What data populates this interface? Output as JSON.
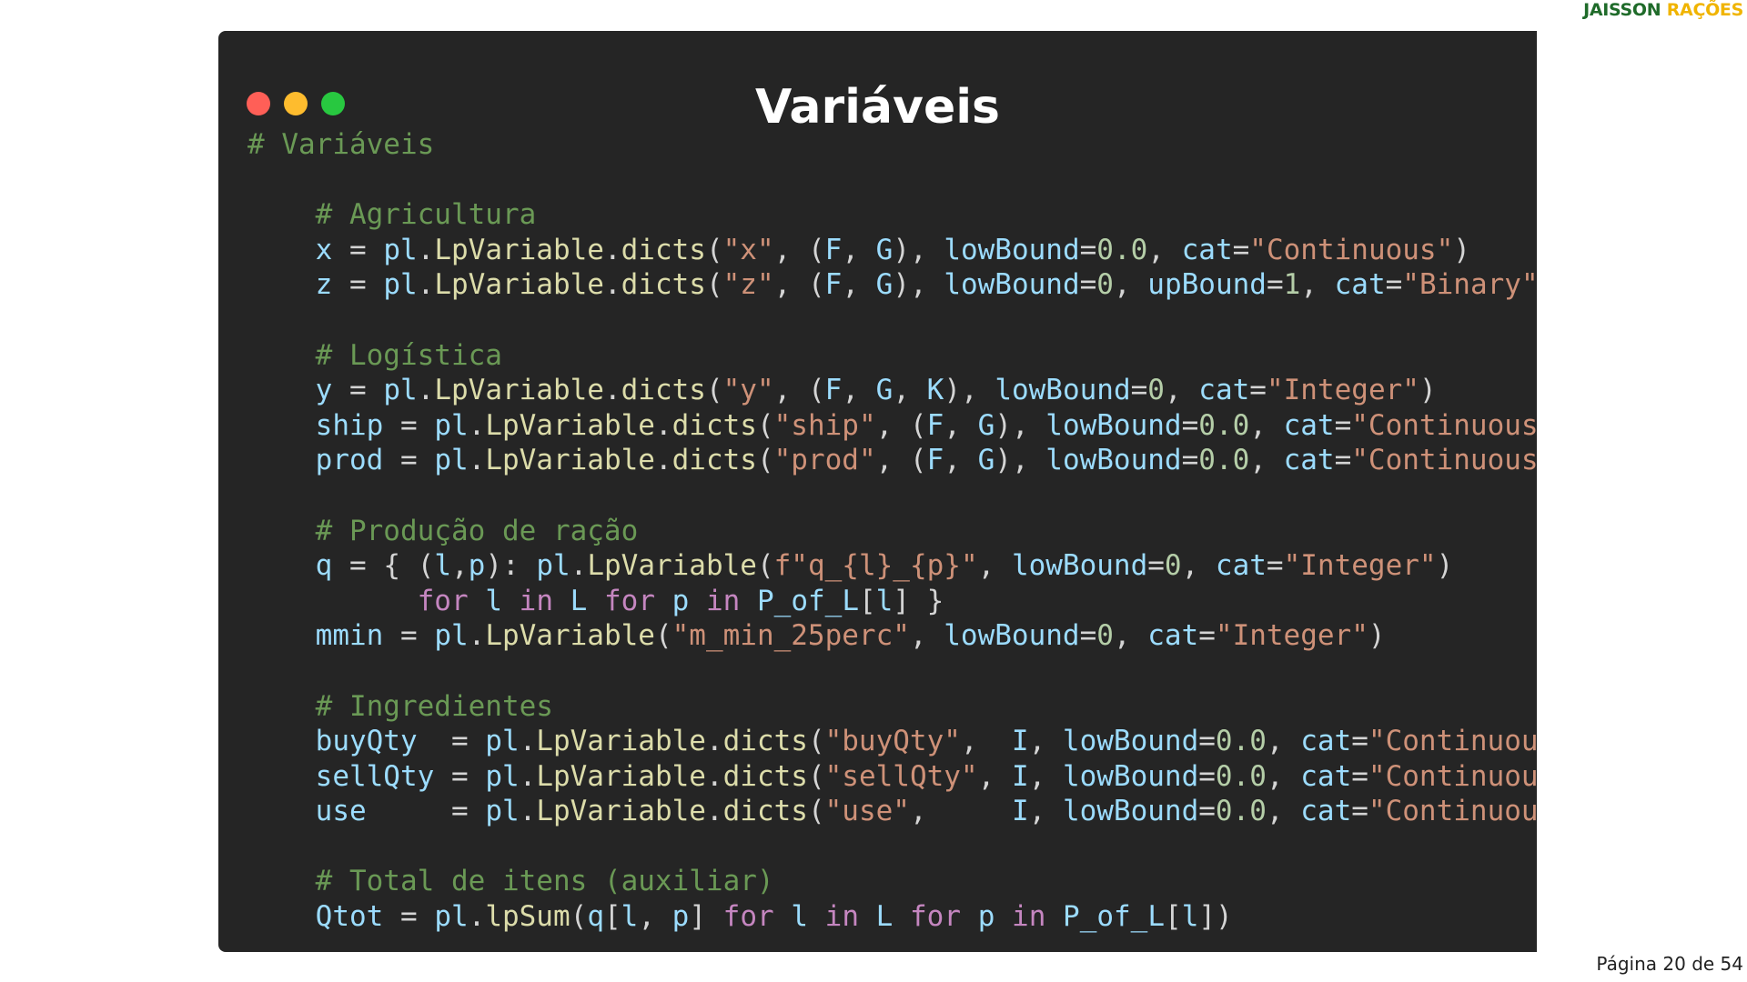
{
  "brand": {
    "part1": "JAISSON",
    "part2": "RAÇÕES",
    "color1": "#1f6b2a",
    "color2": "#f0b400"
  },
  "slide_title": "Variáveis",
  "footer": "Página 20 de 54",
  "window_dots": [
    "red",
    "yellow",
    "green"
  ],
  "code_lines": [
    [
      [
        "comment",
        "# Variáveis"
      ]
    ],
    [],
    [
      [
        "op",
        "    "
      ],
      [
        "comment",
        "# Agricultura"
      ]
    ],
    [
      [
        "op",
        "    "
      ],
      [
        "var",
        "x"
      ],
      [
        "op",
        " = "
      ],
      [
        "var",
        "pl"
      ],
      [
        "op",
        "."
      ],
      [
        "func",
        "LpVariable"
      ],
      [
        "op",
        "."
      ],
      [
        "func",
        "dicts"
      ],
      [
        "op",
        "("
      ],
      [
        "str",
        "\"x\""
      ],
      [
        "op",
        ", ("
      ],
      [
        "var",
        "F"
      ],
      [
        "op",
        ", "
      ],
      [
        "var",
        "G"
      ],
      [
        "op",
        "), "
      ],
      [
        "var",
        "lowBound"
      ],
      [
        "op",
        "="
      ],
      [
        "num",
        "0.0"
      ],
      [
        "op",
        ", "
      ],
      [
        "var",
        "cat"
      ],
      [
        "op",
        "="
      ],
      [
        "str",
        "\"Continuous\""
      ],
      [
        "op",
        ")"
      ]
    ],
    [
      [
        "op",
        "    "
      ],
      [
        "var",
        "z"
      ],
      [
        "op",
        " = "
      ],
      [
        "var",
        "pl"
      ],
      [
        "op",
        "."
      ],
      [
        "func",
        "LpVariable"
      ],
      [
        "op",
        "."
      ],
      [
        "func",
        "dicts"
      ],
      [
        "op",
        "("
      ],
      [
        "str",
        "\"z\""
      ],
      [
        "op",
        ", ("
      ],
      [
        "var",
        "F"
      ],
      [
        "op",
        ", "
      ],
      [
        "var",
        "G"
      ],
      [
        "op",
        "), "
      ],
      [
        "var",
        "lowBound"
      ],
      [
        "op",
        "="
      ],
      [
        "num",
        "0"
      ],
      [
        "op",
        ", "
      ],
      [
        "var",
        "upBound"
      ],
      [
        "op",
        "="
      ],
      [
        "num",
        "1"
      ],
      [
        "op",
        ", "
      ],
      [
        "var",
        "cat"
      ],
      [
        "op",
        "="
      ],
      [
        "str",
        "\"Binary\""
      ],
      [
        "op",
        ")"
      ]
    ],
    [],
    [
      [
        "op",
        "    "
      ],
      [
        "comment",
        "# Logística"
      ]
    ],
    [
      [
        "op",
        "    "
      ],
      [
        "var",
        "y"
      ],
      [
        "op",
        " = "
      ],
      [
        "var",
        "pl"
      ],
      [
        "op",
        "."
      ],
      [
        "func",
        "LpVariable"
      ],
      [
        "op",
        "."
      ],
      [
        "func",
        "dicts"
      ],
      [
        "op",
        "("
      ],
      [
        "str",
        "\"y\""
      ],
      [
        "op",
        ", ("
      ],
      [
        "var",
        "F"
      ],
      [
        "op",
        ", "
      ],
      [
        "var",
        "G"
      ],
      [
        "op",
        ", "
      ],
      [
        "var",
        "K"
      ],
      [
        "op",
        "), "
      ],
      [
        "var",
        "lowBound"
      ],
      [
        "op",
        "="
      ],
      [
        "num",
        "0"
      ],
      [
        "op",
        ", "
      ],
      [
        "var",
        "cat"
      ],
      [
        "op",
        "="
      ],
      [
        "str",
        "\"Integer\""
      ],
      [
        "op",
        ")"
      ]
    ],
    [
      [
        "op",
        "    "
      ],
      [
        "var",
        "ship"
      ],
      [
        "op",
        " = "
      ],
      [
        "var",
        "pl"
      ],
      [
        "op",
        "."
      ],
      [
        "func",
        "LpVariable"
      ],
      [
        "op",
        "."
      ],
      [
        "func",
        "dicts"
      ],
      [
        "op",
        "("
      ],
      [
        "str",
        "\"ship\""
      ],
      [
        "op",
        ", ("
      ],
      [
        "var",
        "F"
      ],
      [
        "op",
        ", "
      ],
      [
        "var",
        "G"
      ],
      [
        "op",
        "), "
      ],
      [
        "var",
        "lowBound"
      ],
      [
        "op",
        "="
      ],
      [
        "num",
        "0.0"
      ],
      [
        "op",
        ", "
      ],
      [
        "var",
        "cat"
      ],
      [
        "op",
        "="
      ],
      [
        "str",
        "\"Continuous\""
      ],
      [
        "op",
        ")"
      ]
    ],
    [
      [
        "op",
        "    "
      ],
      [
        "var",
        "prod"
      ],
      [
        "op",
        " = "
      ],
      [
        "var",
        "pl"
      ],
      [
        "op",
        "."
      ],
      [
        "func",
        "LpVariable"
      ],
      [
        "op",
        "."
      ],
      [
        "func",
        "dicts"
      ],
      [
        "op",
        "("
      ],
      [
        "str",
        "\"prod\""
      ],
      [
        "op",
        ", ("
      ],
      [
        "var",
        "F"
      ],
      [
        "op",
        ", "
      ],
      [
        "var",
        "G"
      ],
      [
        "op",
        "), "
      ],
      [
        "var",
        "lowBound"
      ],
      [
        "op",
        "="
      ],
      [
        "num",
        "0.0"
      ],
      [
        "op",
        ", "
      ],
      [
        "var",
        "cat"
      ],
      [
        "op",
        "="
      ],
      [
        "str",
        "\"Continuous\""
      ],
      [
        "op",
        ")"
      ]
    ],
    [],
    [
      [
        "op",
        "    "
      ],
      [
        "comment",
        "# Produção de ração"
      ]
    ],
    [
      [
        "op",
        "    "
      ],
      [
        "var",
        "q"
      ],
      [
        "op",
        " = { ("
      ],
      [
        "var",
        "l"
      ],
      [
        "op",
        ","
      ],
      [
        "var",
        "p"
      ],
      [
        "op",
        "): "
      ],
      [
        "var",
        "pl"
      ],
      [
        "op",
        "."
      ],
      [
        "func",
        "LpVariable"
      ],
      [
        "op",
        "("
      ],
      [
        "str",
        "f\"q_{l}_{p}\""
      ],
      [
        "op",
        ", "
      ],
      [
        "var",
        "lowBound"
      ],
      [
        "op",
        "="
      ],
      [
        "num",
        "0"
      ],
      [
        "op",
        ", "
      ],
      [
        "var",
        "cat"
      ],
      [
        "op",
        "="
      ],
      [
        "str",
        "\"Integer\""
      ],
      [
        "op",
        ")"
      ]
    ],
    [
      [
        "op",
        "          "
      ],
      [
        "kw",
        "for"
      ],
      [
        "op",
        " "
      ],
      [
        "var",
        "l"
      ],
      [
        "op",
        " "
      ],
      [
        "kw",
        "in"
      ],
      [
        "op",
        " "
      ],
      [
        "var",
        "L"
      ],
      [
        "op",
        " "
      ],
      [
        "kw",
        "for"
      ],
      [
        "op",
        " "
      ],
      [
        "var",
        "p"
      ],
      [
        "op",
        " "
      ],
      [
        "kw",
        "in"
      ],
      [
        "op",
        " "
      ],
      [
        "var",
        "P_of_L"
      ],
      [
        "op",
        "["
      ],
      [
        "var",
        "l"
      ],
      [
        "op",
        "] }"
      ]
    ],
    [
      [
        "op",
        "    "
      ],
      [
        "var",
        "mmin"
      ],
      [
        "op",
        " = "
      ],
      [
        "var",
        "pl"
      ],
      [
        "op",
        "."
      ],
      [
        "func",
        "LpVariable"
      ],
      [
        "op",
        "("
      ],
      [
        "str",
        "\"m_min_25perc\""
      ],
      [
        "op",
        ", "
      ],
      [
        "var",
        "lowBound"
      ],
      [
        "op",
        "="
      ],
      [
        "num",
        "0"
      ],
      [
        "op",
        ", "
      ],
      [
        "var",
        "cat"
      ],
      [
        "op",
        "="
      ],
      [
        "str",
        "\"Integer\""
      ],
      [
        "op",
        ")"
      ]
    ],
    [],
    [
      [
        "op",
        "    "
      ],
      [
        "comment",
        "# Ingredientes"
      ]
    ],
    [
      [
        "op",
        "    "
      ],
      [
        "var",
        "buyQty"
      ],
      [
        "op",
        "  = "
      ],
      [
        "var",
        "pl"
      ],
      [
        "op",
        "."
      ],
      [
        "func",
        "LpVariable"
      ],
      [
        "op",
        "."
      ],
      [
        "func",
        "dicts"
      ],
      [
        "op",
        "("
      ],
      [
        "str",
        "\"buyQty\""
      ],
      [
        "op",
        ",  "
      ],
      [
        "var",
        "I"
      ],
      [
        "op",
        ", "
      ],
      [
        "var",
        "lowBound"
      ],
      [
        "op",
        "="
      ],
      [
        "num",
        "0.0"
      ],
      [
        "op",
        ", "
      ],
      [
        "var",
        "cat"
      ],
      [
        "op",
        "="
      ],
      [
        "str",
        "\"Continuous\""
      ],
      [
        "op",
        ")"
      ]
    ],
    [
      [
        "op",
        "    "
      ],
      [
        "var",
        "sellQty"
      ],
      [
        "op",
        " = "
      ],
      [
        "var",
        "pl"
      ],
      [
        "op",
        "."
      ],
      [
        "func",
        "LpVariable"
      ],
      [
        "op",
        "."
      ],
      [
        "func",
        "dicts"
      ],
      [
        "op",
        "("
      ],
      [
        "str",
        "\"sellQty\""
      ],
      [
        "op",
        ", "
      ],
      [
        "var",
        "I"
      ],
      [
        "op",
        ", "
      ],
      [
        "var",
        "lowBound"
      ],
      [
        "op",
        "="
      ],
      [
        "num",
        "0.0"
      ],
      [
        "op",
        ", "
      ],
      [
        "var",
        "cat"
      ],
      [
        "op",
        "="
      ],
      [
        "str",
        "\"Continuous\""
      ],
      [
        "op",
        ")"
      ]
    ],
    [
      [
        "op",
        "    "
      ],
      [
        "var",
        "use"
      ],
      [
        "op",
        "     = "
      ],
      [
        "var",
        "pl"
      ],
      [
        "op",
        "."
      ],
      [
        "func",
        "LpVariable"
      ],
      [
        "op",
        "."
      ],
      [
        "func",
        "dicts"
      ],
      [
        "op",
        "("
      ],
      [
        "str",
        "\"use\""
      ],
      [
        "op",
        ",     "
      ],
      [
        "var",
        "I"
      ],
      [
        "op",
        ", "
      ],
      [
        "var",
        "lowBound"
      ],
      [
        "op",
        "="
      ],
      [
        "num",
        "0.0"
      ],
      [
        "op",
        ", "
      ],
      [
        "var",
        "cat"
      ],
      [
        "op",
        "="
      ],
      [
        "str",
        "\"Continuous\""
      ],
      [
        "op",
        ")"
      ]
    ],
    [],
    [
      [
        "op",
        "    "
      ],
      [
        "comment",
        "# Total de itens (auxiliar)"
      ]
    ],
    [
      [
        "op",
        "    "
      ],
      [
        "var",
        "Qtot"
      ],
      [
        "op",
        " = "
      ],
      [
        "var",
        "pl"
      ],
      [
        "op",
        "."
      ],
      [
        "func",
        "lpSum"
      ],
      [
        "op",
        "("
      ],
      [
        "var",
        "q"
      ],
      [
        "op",
        "["
      ],
      [
        "var",
        "l"
      ],
      [
        "op",
        ", "
      ],
      [
        "var",
        "p"
      ],
      [
        "op",
        "] "
      ],
      [
        "kw",
        "for"
      ],
      [
        "op",
        " "
      ],
      [
        "var",
        "l"
      ],
      [
        "op",
        " "
      ],
      [
        "kw",
        "in"
      ],
      [
        "op",
        " "
      ],
      [
        "var",
        "L"
      ],
      [
        "op",
        " "
      ],
      [
        "kw",
        "for"
      ],
      [
        "op",
        " "
      ],
      [
        "var",
        "p"
      ],
      [
        "op",
        " "
      ],
      [
        "kw",
        "in"
      ],
      [
        "op",
        " "
      ],
      [
        "var",
        "P_of_L"
      ],
      [
        "op",
        "["
      ],
      [
        "var",
        "l"
      ],
      [
        "op",
        "])"
      ]
    ]
  ]
}
